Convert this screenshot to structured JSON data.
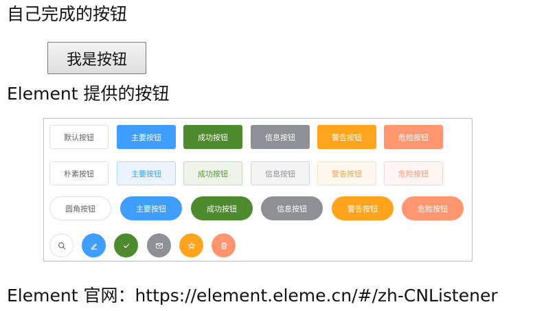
{
  "headings": {
    "own": "自己完成的按钮",
    "element": "Element 提供的按钮",
    "site": "Element 官网：https://element.eleme.cn/#/zh-CNListener"
  },
  "native_button": {
    "label": "我是按钮"
  },
  "element_demo": {
    "default_row": [
      "默认按钮",
      "主要按钮",
      "成功按钮",
      "信息按钮",
      "警告按钮",
      "危险按钮"
    ],
    "plain_row": [
      "朴素按钮",
      "主要按钮",
      "成功按钮",
      "信息按钮",
      "警告按钮",
      "危险按钮"
    ],
    "round_row": [
      "圆角按钮",
      "主要按钮",
      "成功按钮",
      "信息按钮",
      "警告按钮",
      "危险按钮"
    ],
    "circle_row_icons": [
      "search-icon",
      "edit-icon",
      "check-icon",
      "message-icon",
      "star-icon",
      "delete-icon"
    ]
  },
  "colors": {
    "primary": "#409eff",
    "success": "#4e8a2e",
    "info": "#8e9096",
    "warning": "#ffa41c",
    "danger": "#ff9670",
    "default_border": "#dcdfe6"
  }
}
